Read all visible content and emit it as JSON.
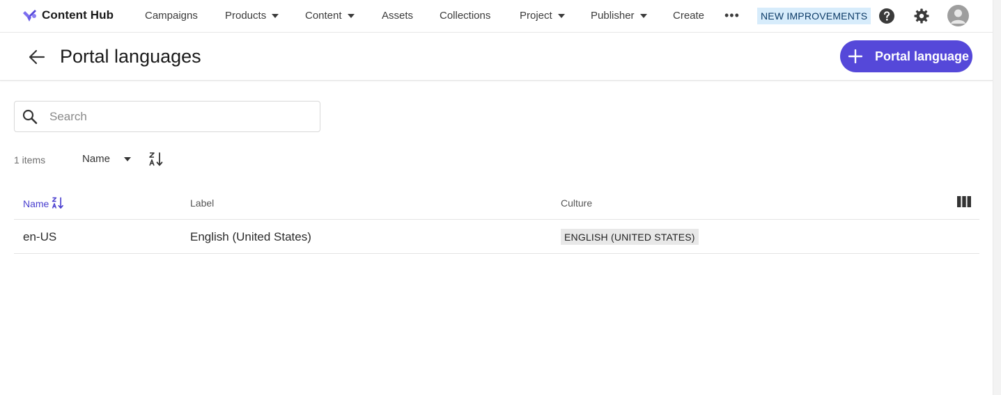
{
  "app": {
    "brand_name": "Content Hub",
    "accent_color": "#5548d9"
  },
  "nav": {
    "items": [
      {
        "label": "Campaigns",
        "has_dropdown": false
      },
      {
        "label": "Products",
        "has_dropdown": true
      },
      {
        "label": "Content",
        "has_dropdown": true
      },
      {
        "label": "Assets",
        "has_dropdown": false
      },
      {
        "label": "Collections",
        "has_dropdown": false
      },
      {
        "label": "Project",
        "has_dropdown": true
      },
      {
        "label": "Publisher",
        "has_dropdown": true
      },
      {
        "label": "Create",
        "has_dropdown": false
      }
    ],
    "more_label": "•••",
    "new_badge": "NEW IMPROVEMENTS",
    "icons": [
      "help-icon",
      "gear-icon",
      "avatar-icon"
    ]
  },
  "header": {
    "title": "Portal languages",
    "primary_button_label": "Portal language"
  },
  "search": {
    "placeholder": "Search",
    "value": ""
  },
  "toolbar": {
    "count_label": "1 items",
    "sort_field": "Name"
  },
  "table": {
    "columns": [
      "Name",
      "Label",
      "Culture"
    ],
    "rows": [
      {
        "name": "en-US",
        "label": "English (United States)",
        "culture": "ENGLISH (UNITED STATES)"
      }
    ]
  }
}
